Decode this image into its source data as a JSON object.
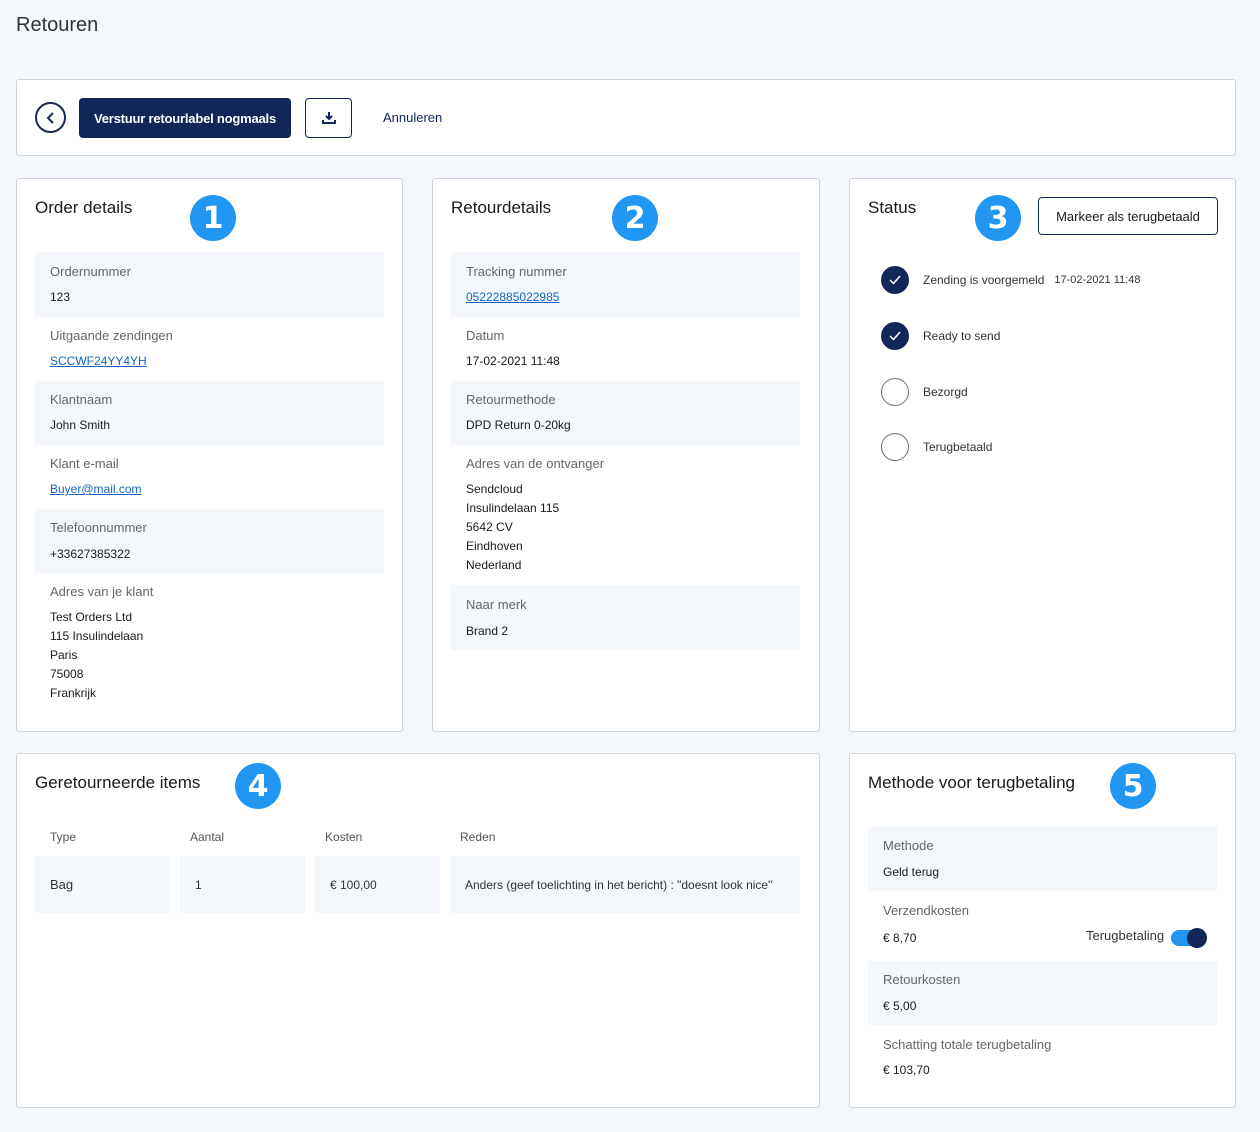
{
  "page": {
    "title": "Retouren"
  },
  "toolbar": {
    "resend_label": "Verstuur retourlabel nogmaals",
    "cancel_label": "Annuleren"
  },
  "order_details": {
    "title": "Order details",
    "badge": "1",
    "fields": [
      {
        "label": "Ordernummer",
        "value": "123"
      },
      {
        "label": "Uitgaande zendingen",
        "value": "SCCWF24YY4YH"
      },
      {
        "label": "Klantnaam",
        "value": "John Smith"
      },
      {
        "label": "Klant e-mail",
        "value": "Buyer@mail.com"
      },
      {
        "label": "Telefoonnummer",
        "value": "+33627385322"
      },
      {
        "label": "Adres van je klant",
        "lines": [
          "Test Orders Ltd",
          "115 Insulindelaan",
          "Paris",
          "75008",
          "Frankrijk"
        ]
      }
    ]
  },
  "return_details": {
    "title": "Retourdetails",
    "badge": "2",
    "fields": [
      {
        "label": "Tracking nummer",
        "value": "05222885022985"
      },
      {
        "label": "Datum",
        "value": "17-02-2021 11:48"
      },
      {
        "label": "Retourmethode",
        "value": "DPD Return 0-20kg"
      },
      {
        "label": "Adres van de ontvanger",
        "lines": [
          "Sendcloud",
          "Insulindelaan 115",
          "5642 CV",
          "Eindhoven",
          "Nederland"
        ]
      },
      {
        "label": "Naar merk",
        "value": "Brand 2"
      }
    ]
  },
  "status": {
    "title": "Status",
    "badge": "3",
    "mark_refunded_label": "Markeer als terugbetaald",
    "steps": [
      {
        "label": "Zending is voorgemeld",
        "date": "17-02-2021 11:48",
        "done": true
      },
      {
        "label": "Ready to send",
        "date": "",
        "done": true
      },
      {
        "label": "Bezorgd",
        "date": "",
        "done": false
      },
      {
        "label": "Terugbetaald",
        "date": "",
        "done": false
      }
    ]
  },
  "returned_items": {
    "title": "Geretourneerde items",
    "badge": "4",
    "columns": [
      "Type",
      "Aantal",
      "Kosten",
      "Reden"
    ],
    "rows": [
      [
        "Bag",
        "1",
        "€ 100,00",
        "Anders (geef toelichting in het bericht) : \"doesnt look nice\""
      ]
    ]
  },
  "refund_method": {
    "title": "Methode voor terugbetaling",
    "badge": "5",
    "method_label": "Methode",
    "method_value": "Geld terug",
    "shipping_label": "Verzendkosten",
    "shipping_value": "€ 8,70",
    "refund_toggle_label": "Terugbetaling",
    "refund_toggle_on": true,
    "return_cost_label": "Retourkosten",
    "return_cost_value": "€ 5,00",
    "total_label": "Schatting totale terugbetaling",
    "total_value": "€ 103,70"
  },
  "colors": {
    "accent": "#13265a",
    "badge": "#2196f3",
    "link": "#1565c0",
    "shade": "#f4f8fc"
  }
}
